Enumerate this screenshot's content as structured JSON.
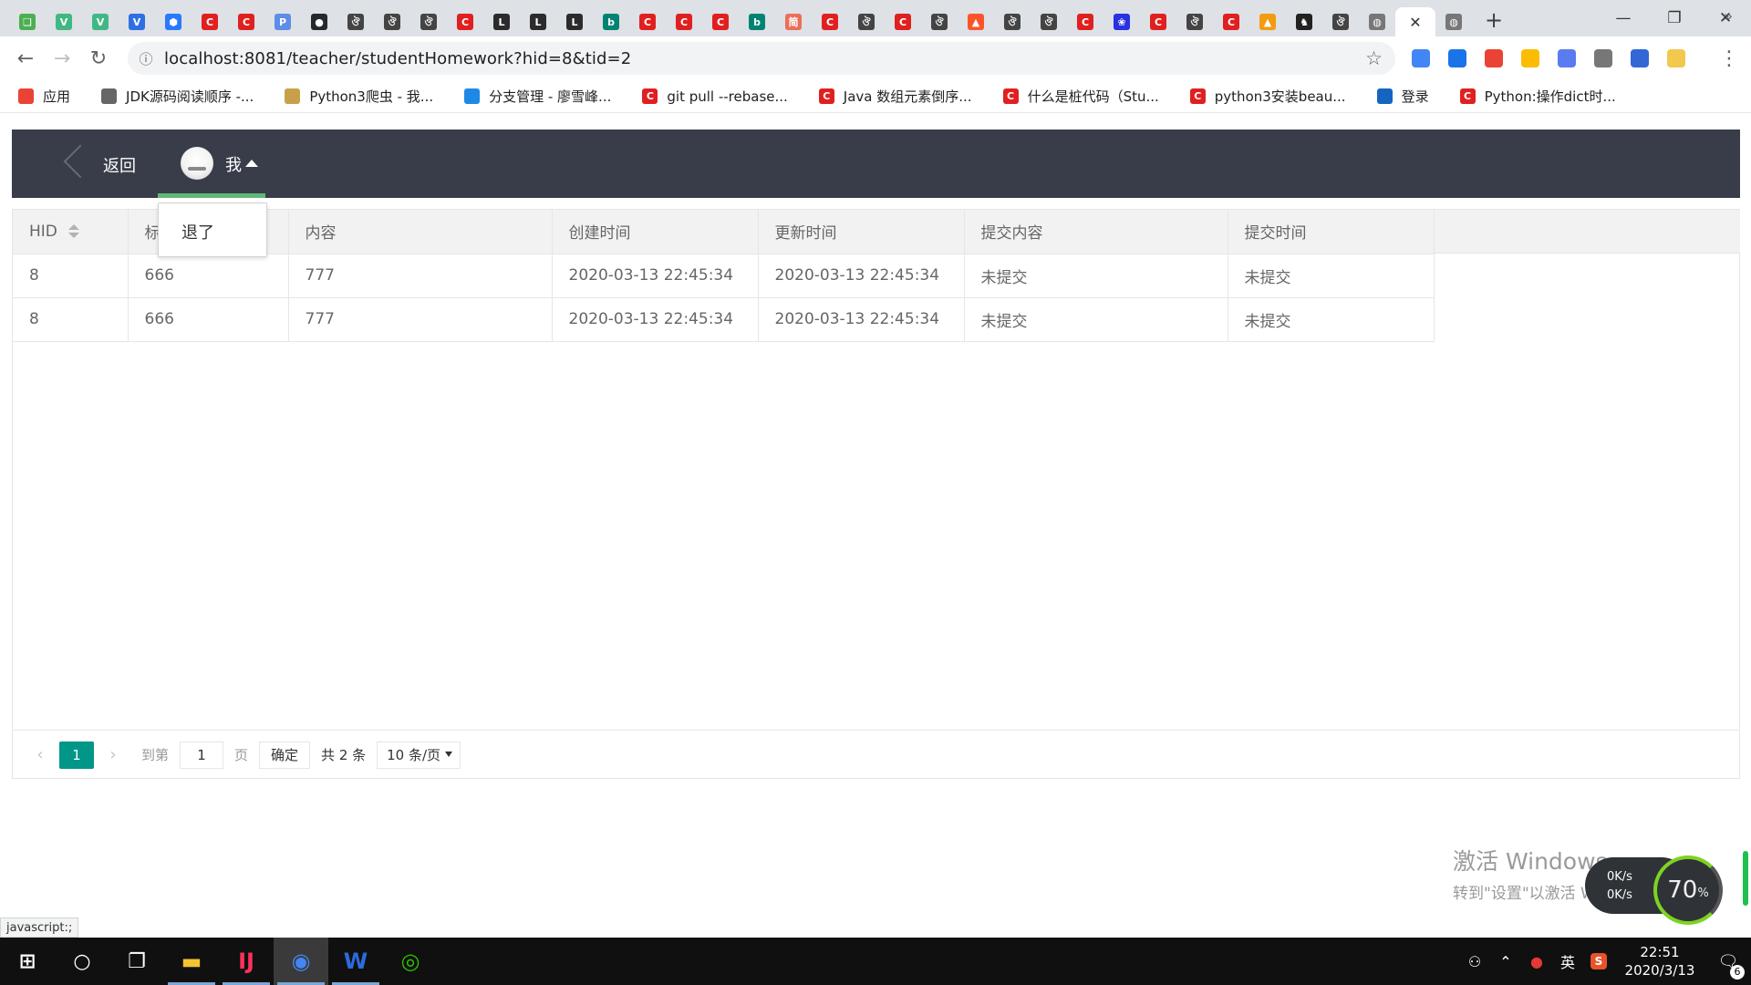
{
  "browser": {
    "tabs": [
      {
        "icon": "book-icon",
        "color": "#4caf50"
      },
      {
        "icon": "vue-icon",
        "color": "#41b883"
      },
      {
        "icon": "vue-icon",
        "color": "#41b883"
      },
      {
        "icon": "shield-v-icon",
        "color": "#2f6fe4"
      },
      {
        "icon": "hex-icon",
        "color": "#2979ff"
      },
      {
        "icon": "csdn-icon",
        "color": "#e02020"
      },
      {
        "icon": "csdn-icon",
        "color": "#e02020"
      },
      {
        "icon": "p-circle-icon",
        "color": "#5c8de8"
      },
      {
        "icon": "github-icon",
        "color": "#24292e"
      },
      {
        "icon": "paw-icon",
        "color": "#444444"
      },
      {
        "icon": "paw-icon",
        "color": "#444444"
      },
      {
        "icon": "paw-icon",
        "color": "#444444"
      },
      {
        "icon": "csdn-icon",
        "color": "#e02020"
      },
      {
        "icon": "leetcode-icon",
        "color": "#2b2b2b"
      },
      {
        "icon": "leetcode-icon",
        "color": "#2b2b2b"
      },
      {
        "icon": "leetcode-icon",
        "color": "#2b2b2b"
      },
      {
        "icon": "bing-icon",
        "color": "#008373"
      },
      {
        "icon": "csdn-icon",
        "color": "#e02020"
      },
      {
        "icon": "csdn-icon",
        "color": "#e02020"
      },
      {
        "icon": "csdn-icon",
        "color": "#e02020"
      },
      {
        "icon": "bing-icon",
        "color": "#008373"
      },
      {
        "icon": "jianshu-icon",
        "color": "#ea6f5a"
      },
      {
        "icon": "csdn-icon",
        "color": "#e02020"
      },
      {
        "icon": "paw-icon",
        "color": "#444444"
      },
      {
        "icon": "csdn-icon",
        "color": "#e02020"
      },
      {
        "icon": "paw-icon",
        "color": "#444444"
      },
      {
        "icon": "brave-icon",
        "color": "#fb542b"
      },
      {
        "icon": "paw-icon",
        "color": "#444444"
      },
      {
        "icon": "paw-icon",
        "color": "#444444"
      },
      {
        "icon": "csdn-icon",
        "color": "#e02020"
      },
      {
        "icon": "baidu-icon",
        "color": "#2932e1"
      },
      {
        "icon": "csdn-icon",
        "color": "#e02020"
      },
      {
        "icon": "paw-icon",
        "color": "#444444"
      },
      {
        "icon": "csdn-icon",
        "color": "#e02020"
      },
      {
        "icon": "pma-icon",
        "color": "#f39c12"
      },
      {
        "icon": "horse-icon",
        "color": "#222222"
      },
      {
        "icon": "paw-icon",
        "color": "#444444"
      },
      {
        "icon": "globe-icon",
        "color": "#777777"
      },
      {
        "icon": "globe-icon",
        "color": "#777777"
      }
    ],
    "url": "localhost:8081/teacher/studentHomework?hid=8&tid=2",
    "extensions": [
      {
        "icon": "translate-icon",
        "color": "#4285f4"
      },
      {
        "icon": "new-badge-icon",
        "color": "#1a73e8"
      },
      {
        "icon": "chrome-store-icon",
        "color": "#ea4335"
      },
      {
        "icon": "pinwheel-icon",
        "color": "#fbbc05"
      },
      {
        "icon": "bird-icon",
        "color": "#5b7cf0"
      },
      {
        "icon": "mail-icon",
        "color": "#777777"
      },
      {
        "icon": "cap-icon",
        "color": "#3367d6"
      },
      {
        "icon": "weather-icon",
        "color": "#f2c94c"
      }
    ],
    "bookmarks": [
      {
        "icon": "apps-grid-icon",
        "label": "应用",
        "color": "#ea4335"
      },
      {
        "icon": "globe-icon",
        "label": "JDK源码阅读顺序 -...",
        "color": "#666666"
      },
      {
        "icon": "python-icon",
        "label": "Python3爬虫 - 我...",
        "color": "#c8a04a"
      },
      {
        "icon": "rocket-icon",
        "label": "分支管理 - 廖雪峰...",
        "color": "#1e88e5"
      },
      {
        "icon": "csdn-icon",
        "label": "git pull --rebase...",
        "color": "#e02020"
      },
      {
        "icon": "csdn-icon",
        "label": "Java 数组元素倒序...",
        "color": "#e02020"
      },
      {
        "icon": "csdn-icon",
        "label": "什么是桩代码（Stu...",
        "color": "#e02020"
      },
      {
        "icon": "csdn-icon",
        "label": "python3安装beau...",
        "color": "#e02020"
      },
      {
        "icon": "login-icon",
        "label": "登录",
        "color": "#1565c0"
      },
      {
        "icon": "csdn-icon",
        "label": "Python:操作dict时...",
        "color": "#e02020"
      }
    ]
  },
  "app": {
    "back_label": "返回",
    "user_name": "我",
    "dropdown_logout": "退了",
    "colors": {
      "header_bg": "#393d49",
      "active_underline": "#5fb878",
      "pager_active": "#009688"
    }
  },
  "table": {
    "columns": [
      "HID",
      "标题",
      "内容",
      "创建时间",
      "更新时间",
      "提交内容",
      "提交时间"
    ],
    "rows": [
      [
        "8",
        "666",
        "777",
        "2020-03-13 22:45:34",
        "2020-03-13 22:45:34",
        "未提交",
        "未提交"
      ],
      [
        "8",
        "666",
        "777",
        "2020-03-13 22:45:34",
        "2020-03-13 22:45:34",
        "未提交",
        "未提交"
      ]
    ]
  },
  "pagination": {
    "current_page": "1",
    "goto_label": "到第",
    "goto_value": "1",
    "page_unit": "页",
    "confirm_label": "确定",
    "total_label": "共 2 条",
    "page_size_label": "10 条/页"
  },
  "overlay": {
    "watermark_title": "激活 Windows",
    "watermark_sub": "转到\"设置\"以激活 Windows。",
    "speed_up": "0K/s",
    "speed_down": "0K/s",
    "cpu_value": "70",
    "cpu_unit": "%",
    "status_text": "javascript:;"
  },
  "taskbar": {
    "apps": [
      {
        "icon": "windows-start-icon",
        "color": "#ffffff"
      },
      {
        "icon": "search-circle-icon",
        "color": "#ffffff"
      },
      {
        "icon": "task-view-icon",
        "color": "#ffffff"
      },
      {
        "icon": "file-explorer-icon",
        "color": "#f4c430"
      },
      {
        "icon": "intellij-icon",
        "color": "#fe315d"
      },
      {
        "icon": "chrome-icon",
        "color": "#4285f4"
      },
      {
        "icon": "wps-icon",
        "color": "#2c6bdc"
      },
      {
        "icon": "wechat-icon",
        "color": "#2dc100"
      }
    ],
    "input_lang": "英",
    "time": "22:51",
    "date": "2020/3/13",
    "notification_count": "6"
  }
}
